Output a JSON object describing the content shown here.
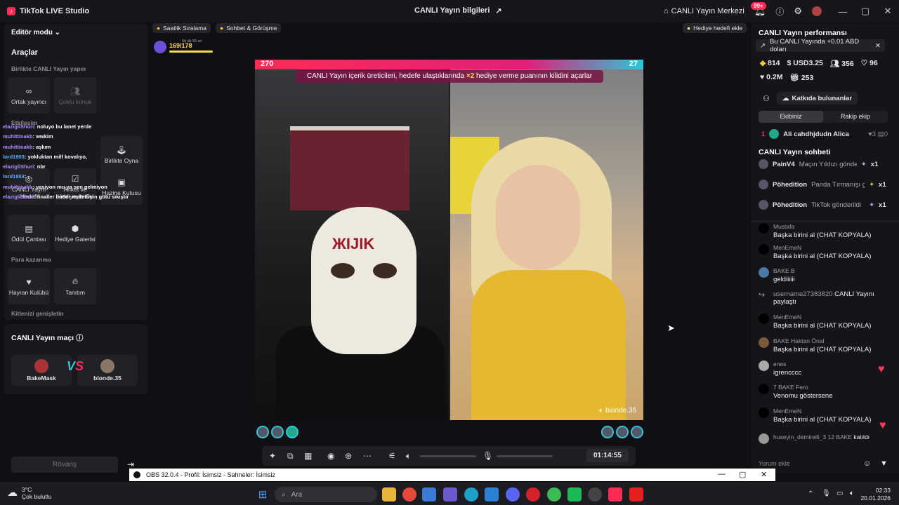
{
  "titlebar": {
    "app_name": "TikTok LIVE Studio",
    "center_title": "CANLI Yayın bilgileri",
    "live_center": "CANLI Yayın Merkezi",
    "notif_badge": "99+"
  },
  "left": {
    "editor_mode": "Editör modu",
    "tools_title": "Araçlar",
    "section_together": "Birlikte CANLI Yayın yapın",
    "co_host": "Ortak yayıncı",
    "multi_guest": "Çoklu konuk",
    "section_interaction": "Etkileşim",
    "live_goal": "CANLI Yayın Hedefi",
    "poll": "Anket ve Hediyeyle Oy",
    "play_together": "Birlikte Oyna",
    "treasure": "Hazine Kutusu",
    "reward_bag": "Ödül Çantası",
    "gift_gallery": "Hediye Galerisi",
    "section_monetize": "Para kazanma",
    "fan_club": "Hayran Kulübü",
    "promote": "Tanıtım",
    "section_extend": "Kitlenizi genişletin",
    "match_title": "CANLI Yayın maçı",
    "player1": "BakeMask",
    "player2": "blonde.35",
    "rematch": "Rövanş"
  },
  "overlay_chat": [
    {
      "user": "elazigliShuri",
      "msg": ": noluyo bu lanet yerde"
    },
    {
      "user": "muhittinakb",
      "msg": ": wwkim"
    },
    {
      "user": "muhittinakb",
      "msg": ": aşkım"
    },
    {
      "user": "lord1903",
      "msg": ": yokluktan milf kovalıyo,"
    },
    {
      "user": "elazigliShuri",
      "msg": ": nbr"
    },
    {
      "user": "lord1903",
      "msg": ": ."
    },
    {
      "user": "muhittinakb",
      "msg": ": yasiyon mu ya sen gelmiyon"
    },
    {
      "user": "elazigliShuri",
      "msg": ": finaller butler muhittinin götü sıkıştır"
    }
  ],
  "center": {
    "chip_hourly": "Saatlik Sıralama",
    "chip_chat": "Sohbet & Görüşme",
    "chip_gift_goal": "Hediye hedefi ekle",
    "progress": "169/178",
    "progress_time": "6d dk 56 sn",
    "score_left": "270",
    "score_right": "27",
    "banner_pre": "CANLI Yayın içerik üreticileri, hedefe ulaştıklarında ",
    "banner_mult": "×2",
    "banner_post": " hediye verme puanının kilidini açarlar",
    "video_name": "blonde.35",
    "timer": "01:14:55"
  },
  "right": {
    "perf_title": "CANLI Yayın performansı",
    "earning": "Bu CANLI Yayında +0.01 ABD doları",
    "stat_diamonds": "814",
    "stat_usd": "USD3.25",
    "stat_viewers": "356",
    "stat_likes_small": "96",
    "stat_likes": "0.2M",
    "stat_gifts": "253",
    "contributors": "Katkıda bulunanlar",
    "tab_team": "Ekibiniz",
    "tab_rival": "Rakip ekip",
    "rank_num": "1",
    "rank_name": "Ali cahdhjdudn Alica",
    "rank_count1": "3",
    "rank_count2": "0",
    "chat_title": "CANLI Yayın sohbeti",
    "gifts": [
      {
        "user": "PainV4",
        "text": "Maçın Yıldızı gönderildi",
        "qty": "x1"
      },
      {
        "user": "Pöhedition",
        "text": "Panda Tırmanışı gö",
        "qty": "x1"
      },
      {
        "user": "Pöhedition",
        "text": "TikTok gönderildi",
        "qty": "x1"
      }
    ],
    "messages": [
      {
        "name": "Mustafa",
        "text": "Başka birini al (CHAT KOPYALA)"
      },
      {
        "name": "MenEmeN",
        "text": "Başka birini al (CHAT KOPYALA)"
      },
      {
        "name": "BAKE B",
        "text": "geldiiiiii"
      },
      {
        "name": "username27383820",
        "text": "CANLI Yayını paylaştı"
      },
      {
        "name": "MenEmeN",
        "text": "Başka birini al (CHAT KOPYALA)"
      },
      {
        "name": "BAKE Haktan Önal",
        "text": "Başka birini al (CHAT KOPYALA)"
      },
      {
        "name": "enes",
        "text": "igrencccc"
      },
      {
        "name": "7 BAKE Fero",
        "text": "Venomu göstersene"
      },
      {
        "name": "MenEmeN",
        "text": "Başka birini al (CHAT KOPYALA)"
      },
      {
        "name": "huseyin_demirelli_3 12 BAKE",
        "text": "katıldı"
      }
    ],
    "comment_placeholder": "Yorum ekle"
  },
  "obs": {
    "title": "OBS 32.0.4 - Profil: İsimsiz - Sahneler: İsimsiz"
  },
  "taskbar": {
    "temp": "3°C",
    "weather": "Çok bulutlu",
    "search": "Ara",
    "time": "02:33",
    "date": "20.01.2026"
  }
}
